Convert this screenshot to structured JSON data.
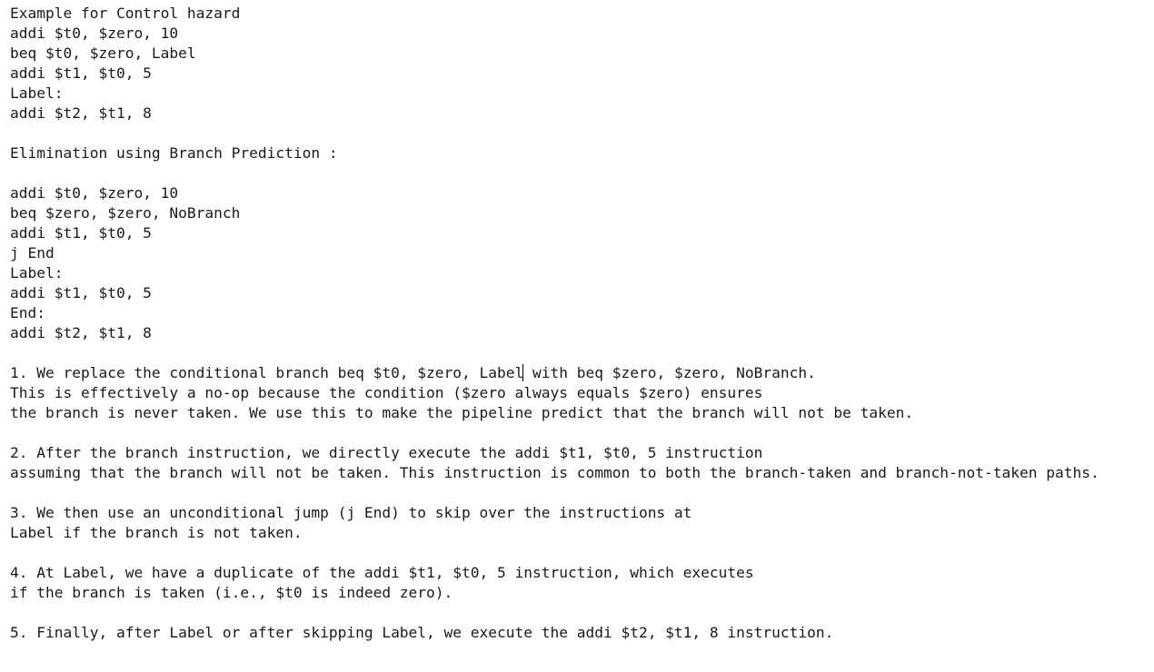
{
  "document": {
    "lines": [
      "Example for Control hazard",
      "addi $t0, $zero, 10",
      "beq $t0, $zero, Label",
      "addi $t1, $t0, 5",
      "Label:",
      "addi $t2, $t1, 8",
      "",
      "Elimination using Branch Prediction :",
      "",
      "addi $t0, $zero, 10",
      "beq $zero, $zero, NoBranch",
      "addi $t1, $t0, 5",
      "j End",
      "Label:",
      "addi $t1, $t0, 5",
      "End:",
      "addi $t2, $t1, 8",
      "",
      "1. We replace the conditional branch beq $t0, $zero, Label",
      "This is effectively a no-op because the condition ($zero always equals $zero) ensures",
      "the branch is never taken. We use this to make the pipeline predict that the branch will not be taken.",
      "",
      "2. After the branch instruction, we directly execute the addi $t1, $t0, 5 instruction",
      "assuming that the branch will not be taken. This instruction is common to both the branch-taken and branch-not-taken paths.",
      "",
      "3. We then use an unconditional jump (j End) to skip over the instructions at",
      "Label if the branch is not taken.",
      "",
      "4. At Label, we have a duplicate of the addi $t1, $t0, 5 instruction, which executes",
      "if the branch is taken (i.e., $t0 is indeed zero).",
      "",
      "5. Finally, after Label or after skipping Label, we execute the addi $t2, $t1, 8 instruction."
    ],
    "line_18_after_caret": " with beq $zero, $zero, NoBranch."
  }
}
